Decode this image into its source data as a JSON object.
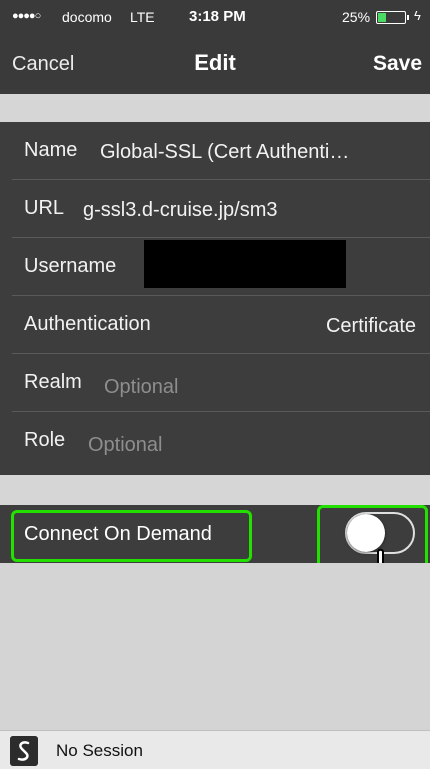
{
  "status_bar": {
    "signal": "●●●●○",
    "carrier": "docomo",
    "network": "LTE",
    "time": "3:18 PM",
    "battery": "25%"
  },
  "nav": {
    "cancel_label": "Cancel",
    "title": "Edit",
    "save_label": "Save"
  },
  "form": {
    "name_label": "Name",
    "name_value": "Global-SSL (Cert Authenti…",
    "url_label": "URL",
    "url_value": "g-ssl3.d-cruise.jp/sm3",
    "username_label": "Username",
    "authentication_label": "Authentication",
    "authentication_value": "Certificate",
    "realm_label": "Realm",
    "realm_placeholder": "Optional",
    "role_label": "Role",
    "role_placeholder": "Optional"
  },
  "connect_on_demand": {
    "label": "Connect On Demand",
    "enabled": false
  },
  "bottom_bar": {
    "status_text": "No Session"
  },
  "colors": {
    "highlight": "#22e000",
    "bar_bg": "#3a3a3a",
    "form_bg": "#3d3d3d",
    "battery_fill": "#4cd964"
  }
}
